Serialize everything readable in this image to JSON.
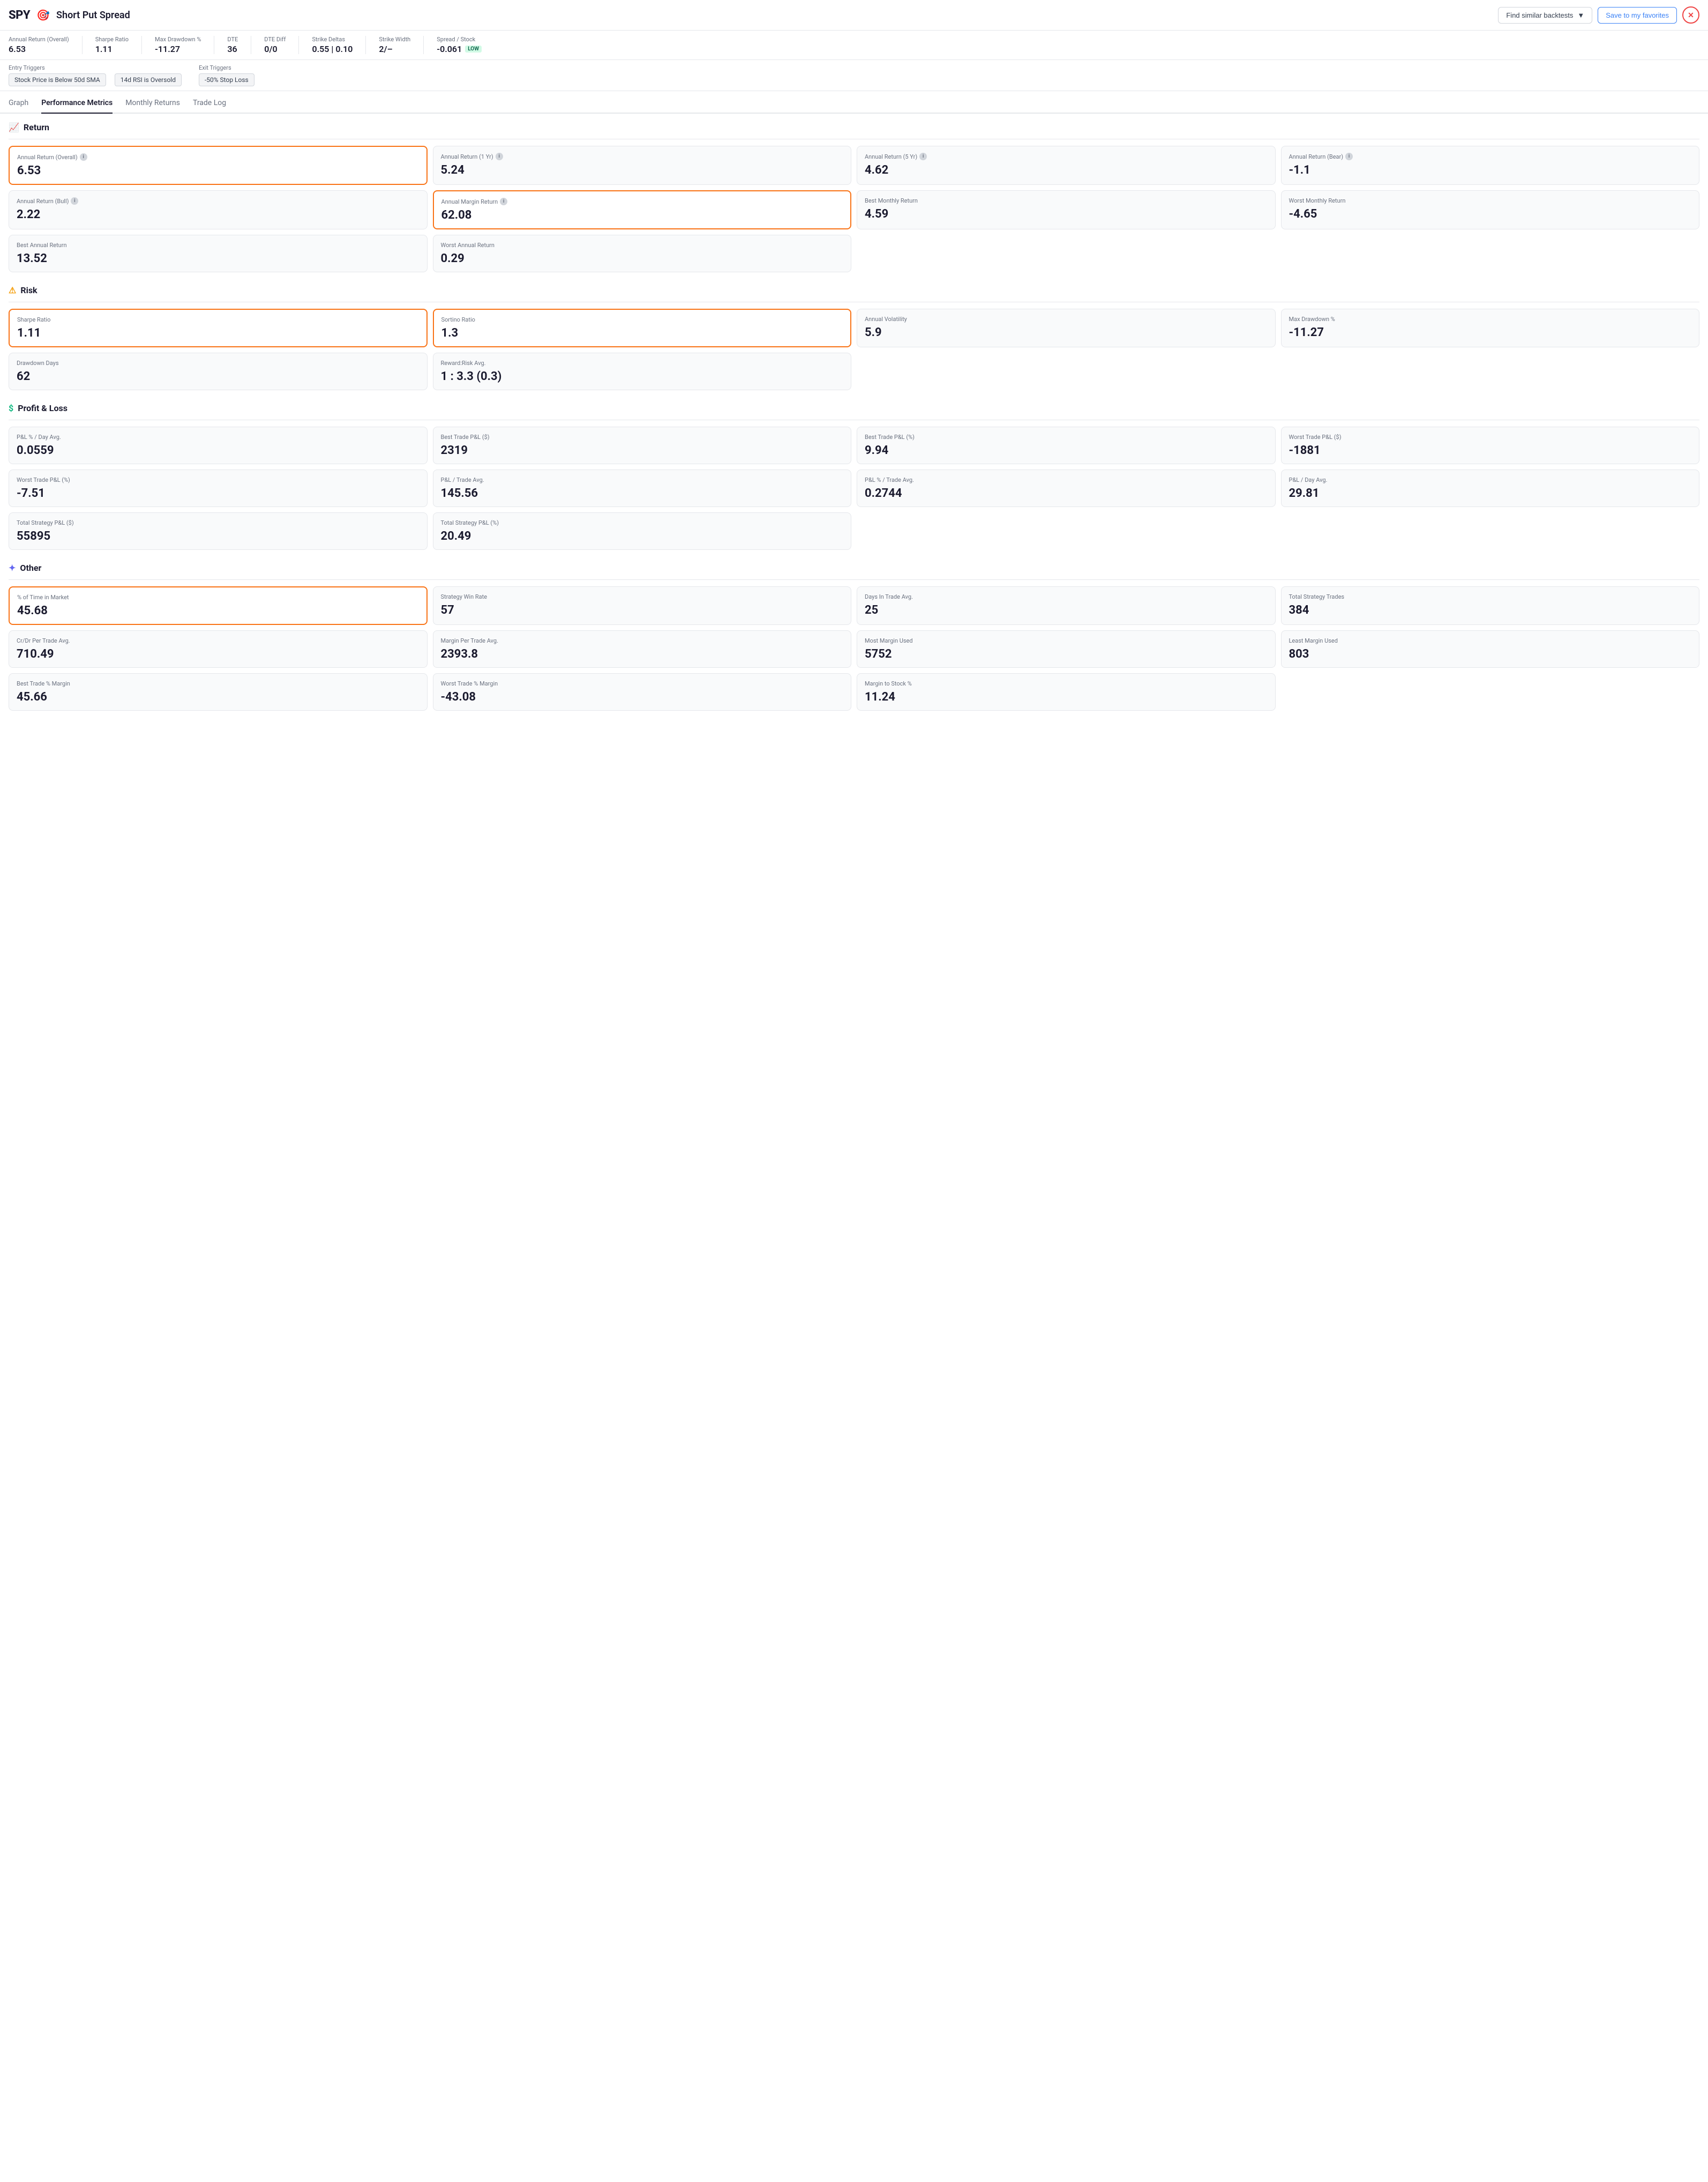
{
  "header": {
    "logo": "SPY",
    "strategy_icon": "🎯",
    "strategy_title": "Short Put Spread",
    "find_similar_label": "Find similar backtests",
    "save_label": "Save to my favorites",
    "close_label": "✕"
  },
  "metrics_bar": [
    {
      "label": "Annual Return (Overall)",
      "value": "6.53"
    },
    {
      "label": "Sharpe Ratio",
      "value": "1.11"
    },
    {
      "label": "Max Drawdown %",
      "value": "-11.27"
    },
    {
      "label": "DTE",
      "value": "36"
    },
    {
      "label": "DTE Diff",
      "value": "0/0"
    },
    {
      "label": "Strike Deltas",
      "value": "0.55 | 0.10"
    },
    {
      "label": "Strike Width",
      "value": "2/–"
    },
    {
      "label": "Spread / Stock",
      "value": "-0.061",
      "badge": "LOW"
    }
  ],
  "triggers": {
    "entry_label": "Entry Triggers",
    "exit_label": "Exit Triggers",
    "entry_tags": [
      "Stock Price is Below 50d SMA",
      "14d RSI is Oversold"
    ],
    "exit_tags": [
      "-50% Stop Loss"
    ]
  },
  "tabs": [
    "Graph",
    "Performance Metrics",
    "Monthly Returns",
    "Trade Log"
  ],
  "active_tab": "Performance Metrics",
  "sections": {
    "return": {
      "title": "Return",
      "icon": "📈",
      "cards": [
        {
          "label": "Annual Return (Overall)",
          "value": "6.53",
          "info": true,
          "highlighted": true
        },
        {
          "label": "Annual Return (1 Yr)",
          "value": "5.24",
          "info": true
        },
        {
          "label": "Annual Return (5 Yr)",
          "value": "4.62",
          "info": true
        },
        {
          "label": "Annual Return (Bear)",
          "value": "-1.1",
          "info": true
        },
        {
          "label": "Annual Return (Bull)",
          "value": "2.22",
          "info": true
        },
        {
          "label": "Annual Margin Return",
          "value": "62.08",
          "info": true,
          "highlighted": true
        },
        {
          "label": "Best Monthly Return",
          "value": "4.59"
        },
        {
          "label": "Worst Monthly Return",
          "value": "-4.65"
        },
        {
          "label": "Best Annual Return",
          "value": "13.52"
        },
        {
          "label": "Worst Annual Return",
          "value": "0.29"
        }
      ]
    },
    "risk": {
      "title": "Risk",
      "icon": "⚠",
      "cards": [
        {
          "label": "Sharpe Ratio",
          "value": "1.11",
          "highlighted": true
        },
        {
          "label": "Sortino Ratio",
          "value": "1.3",
          "highlighted": true
        },
        {
          "label": "Annual Volatility",
          "value": "5.9"
        },
        {
          "label": "Max Drawdown %",
          "value": "-11.27"
        },
        {
          "label": "Drawdown Days",
          "value": "62"
        },
        {
          "label": "Reward:Risk Avg.",
          "value": "1 : 3.3 (0.3)"
        }
      ]
    },
    "pnl": {
      "title": "Profit & Loss",
      "icon": "$",
      "cards": [
        {
          "label": "P&L % / Day Avg.",
          "value": "0.0559"
        },
        {
          "label": "Best Trade P&L ($)",
          "value": "2319"
        },
        {
          "label": "Best Trade P&L (%)",
          "value": "9.94"
        },
        {
          "label": "Worst Trade P&L ($)",
          "value": "-1881"
        },
        {
          "label": "Worst Trade P&L (%)",
          "value": "-7.51"
        },
        {
          "label": "P&L / Trade Avg.",
          "value": "145.56"
        },
        {
          "label": "P&L % / Trade Avg.",
          "value": "0.2744"
        },
        {
          "label": "P&L / Day Avg.",
          "value": "29.81"
        },
        {
          "label": "Total Strategy P&L ($)",
          "value": "55895"
        },
        {
          "label": "Total Strategy P&L (%)",
          "value": "20.49"
        }
      ]
    },
    "other": {
      "title": "Other",
      "icon": "✦",
      "cards": [
        {
          "label": "% of Time in Market",
          "value": "45.68",
          "highlighted": true
        },
        {
          "label": "Strategy Win Rate",
          "value": "57"
        },
        {
          "label": "Days In Trade Avg.",
          "value": "25"
        },
        {
          "label": "Total Strategy Trades",
          "value": "384"
        },
        {
          "label": "Cr/Dr Per Trade Avg.",
          "value": "710.49"
        },
        {
          "label": "Margin Per Trade Avg.",
          "value": "2393.8"
        },
        {
          "label": "Most Margin Used",
          "value": "5752"
        },
        {
          "label": "Least Margin Used",
          "value": "803"
        },
        {
          "label": "Best Trade % Margin",
          "value": "45.66"
        },
        {
          "label": "Worst Trade % Margin",
          "value": "-43.08"
        },
        {
          "label": "Margin to Stock %",
          "value": "11.24"
        }
      ]
    }
  }
}
